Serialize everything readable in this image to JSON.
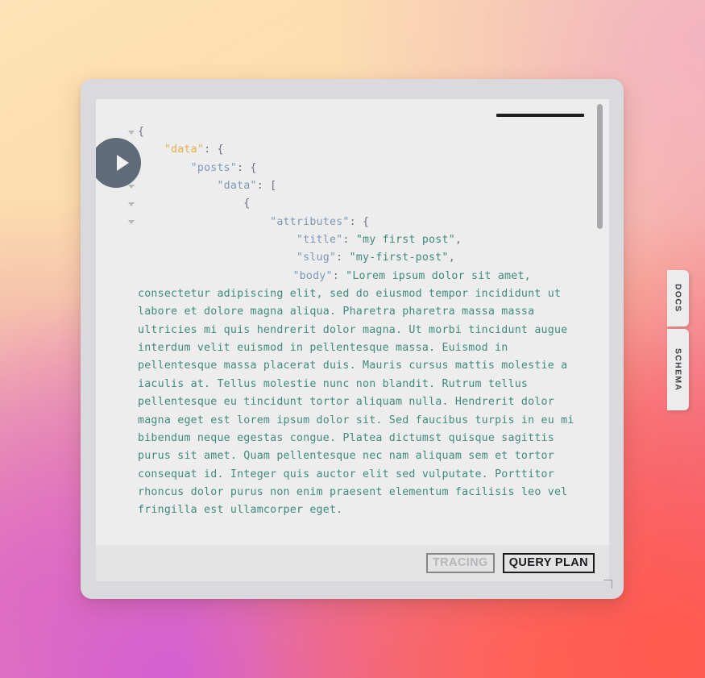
{
  "background": {
    "gradient_colors": [
      "#fde4b6",
      "#fbd9a8",
      "#f7a495",
      "#ff5a4e",
      "#e77ab8",
      "#d95fc9"
    ]
  },
  "window": {
    "frame_color": "#d9d9de",
    "panel_color": "#ededee",
    "toolbar_color": "#e3e3e4"
  },
  "execute": {
    "icon": "play-icon",
    "color": "#5f6b78"
  },
  "scrollbar": {
    "thumb_color": "#a8a9ac"
  },
  "side_tabs": [
    {
      "id": "docs",
      "label": "DOCS"
    },
    {
      "id": "schema",
      "label": "SCHEMA"
    }
  ],
  "toolbar": {
    "tracing_label": "TRACING",
    "tracing_enabled": false,
    "query_plan_label": "QUERY PLAN",
    "query_plan_enabled": true
  },
  "syntax_colors": {
    "punctuation": "#6b7280",
    "key": "#7d99b8",
    "key_highlight": "#e8b04b",
    "string": "#3f8b7d"
  },
  "fold_arrows_count": 6,
  "result": {
    "lines": [
      {
        "indent": 0,
        "parts": [
          {
            "t": "{",
            "c": "punct"
          }
        ]
      },
      {
        "indent": 1,
        "parts": [
          {
            "t": "\"data\"",
            "c": "key-hl"
          },
          {
            "t": ": {",
            "c": "punct"
          }
        ]
      },
      {
        "indent": 2,
        "parts": [
          {
            "t": "\"posts\"",
            "c": "key"
          },
          {
            "t": ": {",
            "c": "punct"
          }
        ]
      },
      {
        "indent": 3,
        "parts": [
          {
            "t": "\"data\"",
            "c": "key"
          },
          {
            "t": ": [",
            "c": "punct"
          }
        ]
      },
      {
        "indent": 4,
        "parts": [
          {
            "t": "{",
            "c": "punct"
          }
        ]
      },
      {
        "indent": 5,
        "parts": [
          {
            "t": "\"attributes\"",
            "c": "key"
          },
          {
            "t": ": {",
            "c": "punct"
          }
        ]
      },
      {
        "indent": 6,
        "parts": [
          {
            "t": "\"title\"",
            "c": "key"
          },
          {
            "t": ": ",
            "c": "punct"
          },
          {
            "t": "\"my first post\"",
            "c": "str"
          },
          {
            "t": ",",
            "c": "punct"
          }
        ]
      },
      {
        "indent": 6,
        "parts": [
          {
            "t": "\"slug\"",
            "c": "key"
          },
          {
            "t": ": ",
            "c": "punct"
          },
          {
            "t": "\"my-first-post\"",
            "c": "str"
          },
          {
            "t": ",",
            "c": "punct"
          }
        ]
      },
      {
        "indent": 6,
        "wrap": true,
        "parts": [
          {
            "t": "\"body\"",
            "c": "key"
          },
          {
            "t": ": ",
            "c": "punct"
          },
          {
            "t": "\"Lorem ipsum dolor sit amet, consectetur adipiscing elit, sed do eiusmod tempor incididunt ut labore et dolore magna aliqua. Pharetra pharetra massa massa ultricies mi quis hendrerit dolor magna. Ut morbi tincidunt augue interdum velit euismod in pellentesque massa. Euismod in pellentesque massa placerat duis. Mauris cursus mattis molestie a iaculis at. Tellus molestie nunc non blandit. Rutrum tellus pellentesque eu tincidunt tortor aliquam nulla. Hendrerit dolor magna eget est lorem ipsum dolor sit. Sed faucibus turpis in eu mi bibendum neque egestas congue. Platea dictumst quisque sagittis purus sit amet. Quam pellentesque nec nam aliquam sem et tortor consequat id. Integer quis auctor elit sed vulputate. Porttitor rhoncus dolor purus non enim praesent elementum facilisis leo vel fringilla est ullamcorper eget.",
            "c": "str"
          }
        ]
      }
    ]
  }
}
